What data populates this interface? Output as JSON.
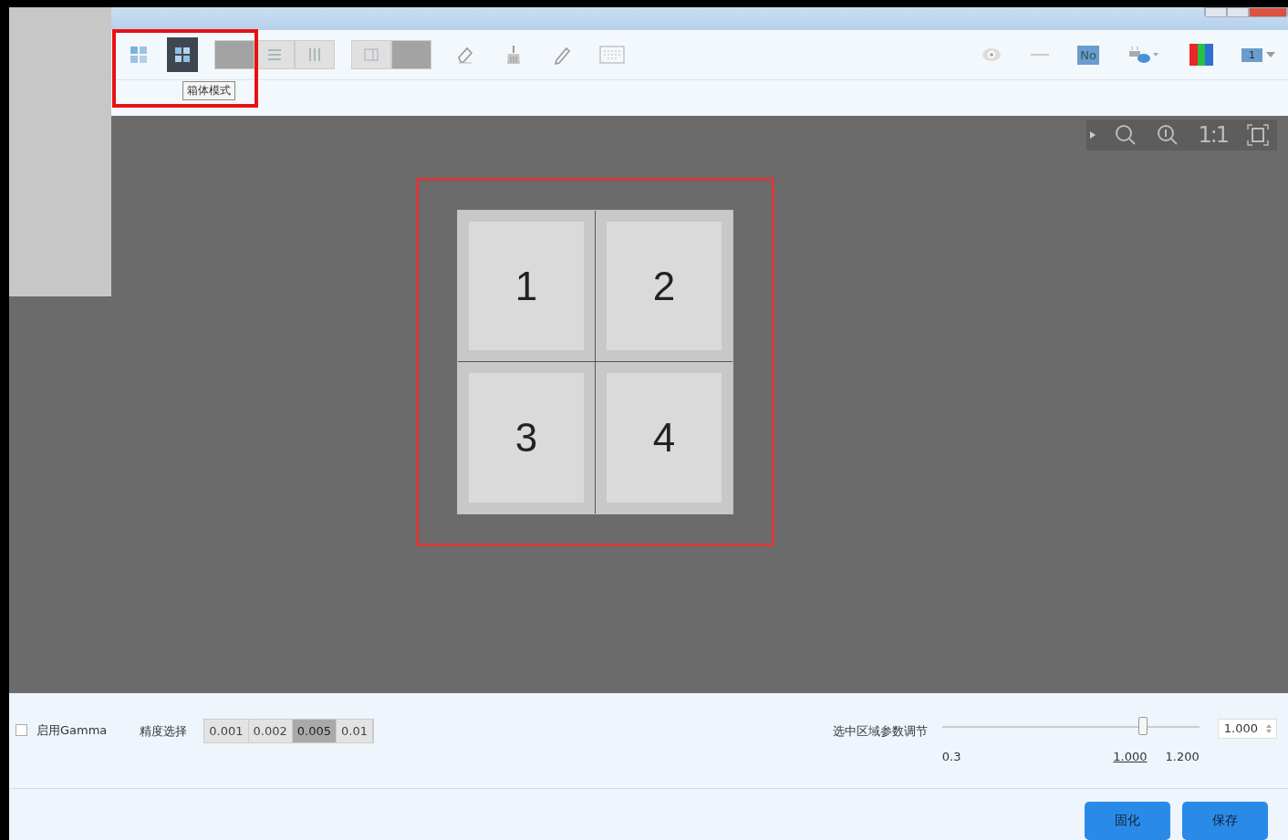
{
  "toolbar": {
    "modes": [
      {
        "kind": "grid",
        "selected": false
      },
      {
        "kind": "cabinet",
        "selected": true
      }
    ],
    "layout_group": [
      {
        "kind": "blank",
        "selected": true
      },
      {
        "kind": "rows",
        "selected": false
      },
      {
        "kind": "columns",
        "selected": false
      }
    ],
    "view_group": [
      {
        "kind": "panel",
        "selected": false
      },
      {
        "kind": "fill",
        "selected": true
      }
    ],
    "tools": [
      {
        "kind": "eraser"
      },
      {
        "kind": "brush"
      },
      {
        "kind": "pen"
      },
      {
        "kind": "keyboard"
      }
    ],
    "right_tools": [
      {
        "kind": "eye"
      },
      {
        "kind": "dash"
      },
      {
        "kind": "tag",
        "label": "No"
      },
      {
        "kind": "lamp"
      },
      {
        "kind": "rgb"
      },
      {
        "kind": "number",
        "label": "1"
      }
    ],
    "tooltip": "箱体模式"
  },
  "zoom_bar": [
    {
      "kind": "zoom-out"
    },
    {
      "kind": "zoom-in"
    },
    {
      "kind": "text",
      "label": "1:1"
    },
    {
      "kind": "fit"
    }
  ],
  "cabinet_grid": {
    "selected": true,
    "cabinets": [
      {
        "label": "1"
      },
      {
        "label": "2"
      },
      {
        "label": "3"
      },
      {
        "label": "4"
      }
    ]
  },
  "gamma": {
    "label": "启用Gamma",
    "checked": false
  },
  "precision": {
    "label": "精度选择",
    "options": [
      {
        "label": "0.001",
        "selected": false
      },
      {
        "label": "0.002",
        "selected": false
      },
      {
        "label": "0.005",
        "selected": true
      },
      {
        "label": "0.01",
        "selected": false
      }
    ]
  },
  "adjust": {
    "label": "选中区域参数调节",
    "level": 0.78,
    "min": "0.3",
    "current": "1.000",
    "max": "1.200",
    "value": "1.000"
  },
  "buttons": [
    "固化",
    "保存"
  ]
}
